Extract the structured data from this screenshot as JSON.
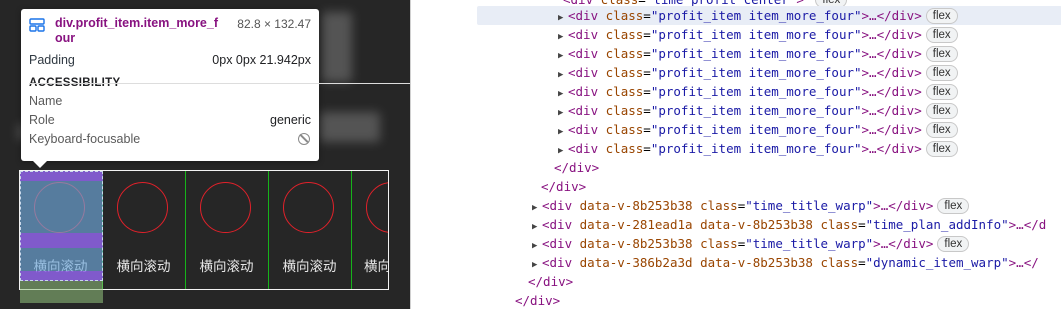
{
  "tooltip": {
    "selector": "div.profit_item.item_more_four",
    "size": "82.8 × 132.47",
    "padding_label": "Padding",
    "padding_value": "0px 0px 21.942px",
    "section_title": "ACCESSIBILITY",
    "name_label": "Name",
    "name_value": "",
    "role_label": "Role",
    "role_value": "generic",
    "focus_label": "Keyboard-focusable",
    "focus_icon": "not-allowed-icon"
  },
  "strip": {
    "items": [
      {
        "label": "横向滚动"
      },
      {
        "label": "横向滚动"
      },
      {
        "label": "横向滚动"
      },
      {
        "label": "横向滚动"
      },
      {
        "label": "横向"
      }
    ],
    "colors": {
      "circle": "#e0212a",
      "separator": "#16b31a",
      "border": "#f3f3f3",
      "bg": "#262626"
    }
  },
  "dom_tree": {
    "top_partial": {
      "tag": "div",
      "attr": "class",
      "value": "time_profit_center"
    },
    "items": [
      {
        "open": "<div",
        "attr": "class",
        "value": "\"profit_item item_more_four\"",
        "close": ">…</div>",
        "badge": "flex"
      },
      {
        "open": "<div",
        "attr": "class",
        "value": "\"profit_item item_more_four\"",
        "close": ">…</div>",
        "badge": "flex"
      },
      {
        "open": "<div",
        "attr": "class",
        "value": "\"profit_item item_more_four\"",
        "close": ">…</div>",
        "badge": "flex"
      },
      {
        "open": "<div",
        "attr": "class",
        "value": "\"profit_item item_more_four\"",
        "close": ">…</div>",
        "badge": "flex"
      },
      {
        "open": "<div",
        "attr": "class",
        "value": "\"profit_item item_more_four\"",
        "close": ">…</div>",
        "badge": "flex"
      },
      {
        "open": "<div",
        "attr": "class",
        "value": "\"profit_item item_more_four\"",
        "close": ">…</div>",
        "badge": "flex"
      },
      {
        "open": "<div",
        "attr": "class",
        "value": "\"profit_item item_more_four\"",
        "close": ">…</div>",
        "badge": "flex"
      },
      {
        "open": "<div",
        "attr": "class",
        "value": "\"profit_item item_more_four\"",
        "close": ">…</div>",
        "badge": "flex"
      }
    ],
    "close1": "</div>",
    "close2": "</div>",
    "rows": [
      {
        "open": "<div",
        "a1": "data-v-8b253b38",
        "a2": "class",
        "v2": "\"time_title_warp\"",
        "close": ">…</div>",
        "badge": "flex"
      },
      {
        "open": "<div",
        "a1": "data-v-281ead1a",
        "a1b": "data-v-8b253b38",
        "a2": "class",
        "v2": "\"time_plan_addInfo\"",
        "close": ">…</d"
      },
      {
        "open": "<div",
        "a1": "data-v-8b253b38",
        "a2": "class",
        "v2": "\"time_title_warp\"",
        "close": ">…</div>",
        "badge": "flex"
      },
      {
        "open": "<div",
        "a1": "data-v-386b2a3d",
        "a1b": "data-v-8b253b38",
        "a2": "class",
        "v2": "\"dynamic_item_warp\"",
        "close": ">…</"
      }
    ],
    "close3": "</div>",
    "close4": "</div>"
  }
}
